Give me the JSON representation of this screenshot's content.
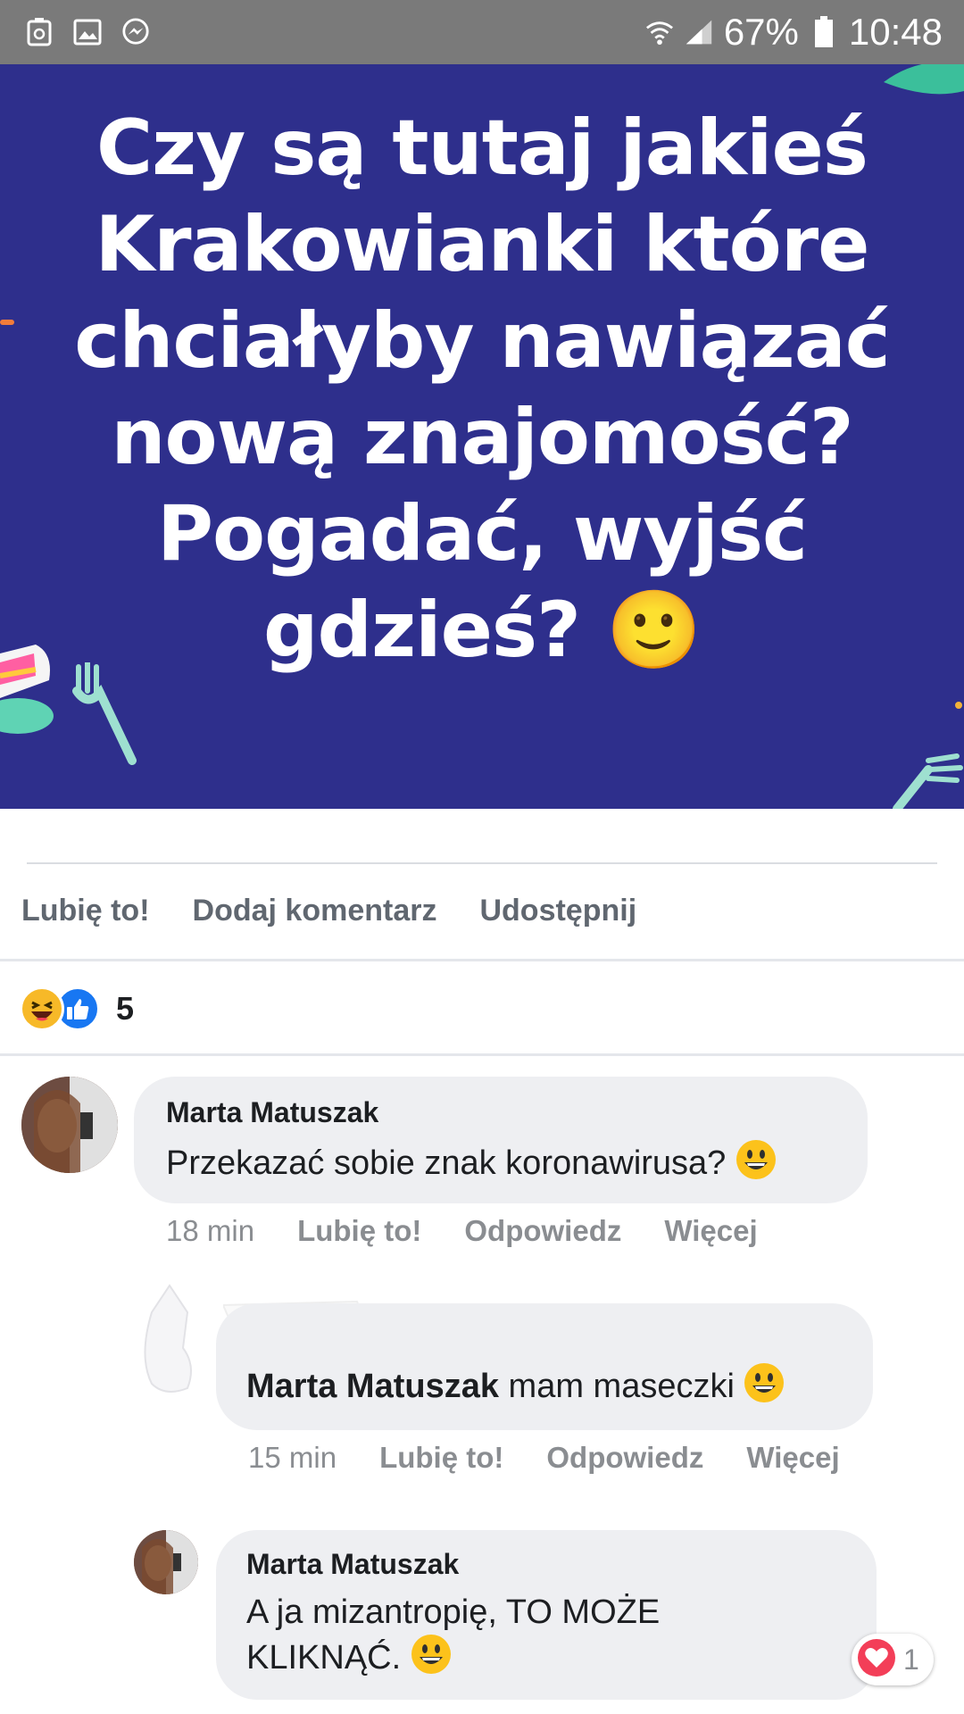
{
  "status_bar": {
    "battery": "67%",
    "time": "10:48",
    "icons": [
      "recycle-battery-icon",
      "gallery-icon",
      "messenger-icon",
      "wifi-icon",
      "signal-icon",
      "battery-icon"
    ]
  },
  "post": {
    "banner_text": "Czy są tutaj jakieś Krakowianki które chciałyby nawiązać nową znajomość? Pogadać, wyjść gdzieś? 🙂",
    "banner_color": "#2e2f8c"
  },
  "actions": {
    "like": "Lubię to!",
    "comment": "Dodaj komentarz",
    "share": "Udostępnij"
  },
  "reactions": {
    "icons": [
      "haha-icon",
      "like-icon"
    ],
    "count": "5"
  },
  "comments": [
    {
      "author": "Marta Matuszak",
      "text": "Przekazać sobie znak koronawirusa?",
      "emoji": "😀",
      "time": "18 min",
      "like": "Lubię to!",
      "reply": "Odpowiedz",
      "more": "Więcej"
    },
    {
      "author": "Marta Matuszak",
      "text": "mam maseczki",
      "emoji": "😀",
      "time": "15 min",
      "like": "Lubię to!",
      "reply": "Odpowiedz",
      "more": "Więcej"
    },
    {
      "author": "Marta Matuszak",
      "text": "A ja mizantropię, TO MOŻE KLIKNĄĆ.",
      "emoji": "😀",
      "reaction_count": "1"
    }
  ],
  "colors": {
    "accent_like": "#1877f2",
    "heart": "#f33e58",
    "bubble": "#eeeff2"
  }
}
